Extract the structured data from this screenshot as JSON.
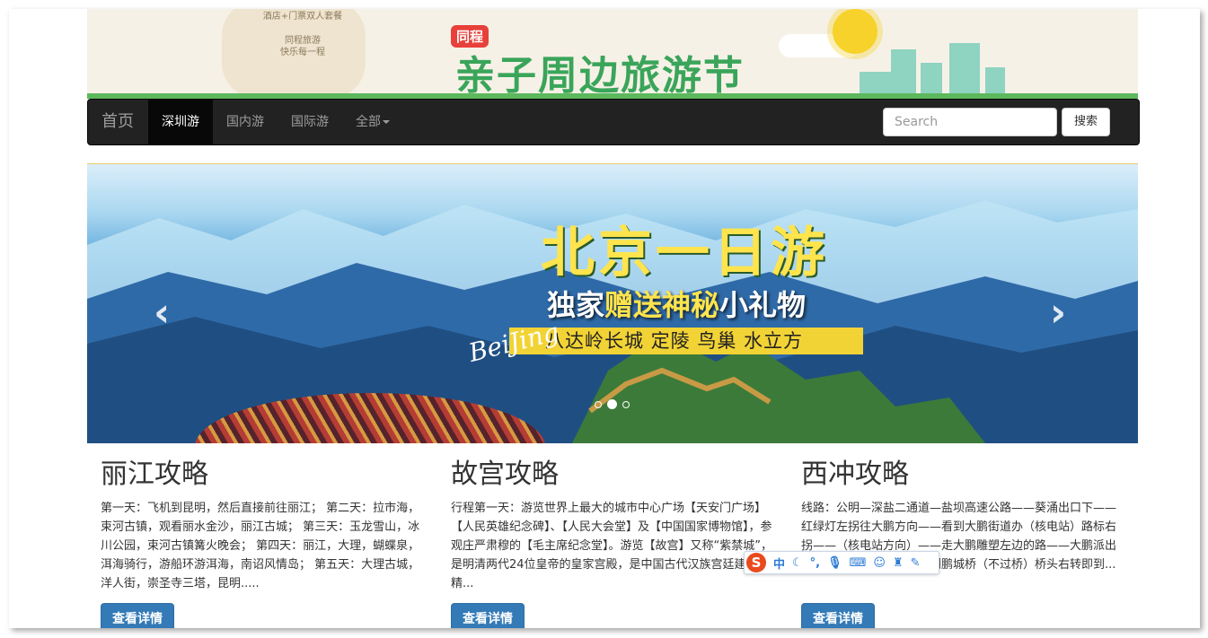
{
  "banner": {
    "bubble_lines": [
      "酒店+门票双人套餐",
      "同程旅游",
      "快乐每一程"
    ],
    "badge": "同程",
    "title": "亲子周边旅游节"
  },
  "navbar": {
    "brand": "首页",
    "items": [
      {
        "label": "深圳游",
        "active": true
      },
      {
        "label": "国内游",
        "active": false
      },
      {
        "label": "国际游",
        "active": false
      },
      {
        "label": "全部",
        "active": false,
        "dropdown": true
      }
    ],
    "search_placeholder": "Search",
    "search_button": "搜索"
  },
  "carousel": {
    "title": "北京一日游",
    "subtitle_pre": "独家",
    "subtitle_highlight": "赠送神秘",
    "subtitle_post": "小礼物",
    "script_text": "BeiJing",
    "places": "八达岭长城  定陵  鸟巢  水立方",
    "prev_icon": "‹",
    "next_icon": "›",
    "indicators": [
      false,
      true,
      false
    ]
  },
  "cards": [
    {
      "title": "丽江攻略",
      "text": "第一天：飞机到昆明，然后直接前往丽江； 第二天：拉市海，束河古镇，观看丽水金沙，丽江古城； 第三天：玉龙雪山，冰川公园，束河古镇篝火晚会； 第四天：丽江，大理，蝴蝶泉，洱海骑行，游船环游洱海，南诏风情岛； 第五天：大理古城，洋人街，崇圣寺三塔，昆明.....",
      "button": "查看详情"
    },
    {
      "title": "故宫攻略",
      "text": "行程第一天：游览世界上最大的城市中心广场【天安门广场】【人民英雄纪念碑】、【人民大会堂】及【中国国家博物馆】，参观庄严肃穆的【毛主席纪念堂】。游览【故宫】又称“紫禁城”，是明清两代24位皇帝的皇家宫殿，是中国古代汉族宫廷建筑之精...",
      "button": "查看详情"
    },
    {
      "title": "西冲攻略",
      "text": "线路：公明—深盐二通道—盐坝高速公路——葵涌出口下——红绿灯左拐往大鹏方向——看到大鹏街道办（核电站）路标右拐——（核电站方向）——走大鹏雕塑左边的路——大鹏派出所—过红绿灯两百米处看到鹏城桥（不过桥）桥头右转即到...",
      "button": "查看详情"
    }
  ],
  "ime": {
    "logo": "S",
    "mode": "中",
    "icons": [
      "moon-icon",
      "punctuation-icon",
      "mic-icon",
      "keyboard-icon",
      "user-icon",
      "shirt-icon",
      "wrench-icon"
    ]
  }
}
